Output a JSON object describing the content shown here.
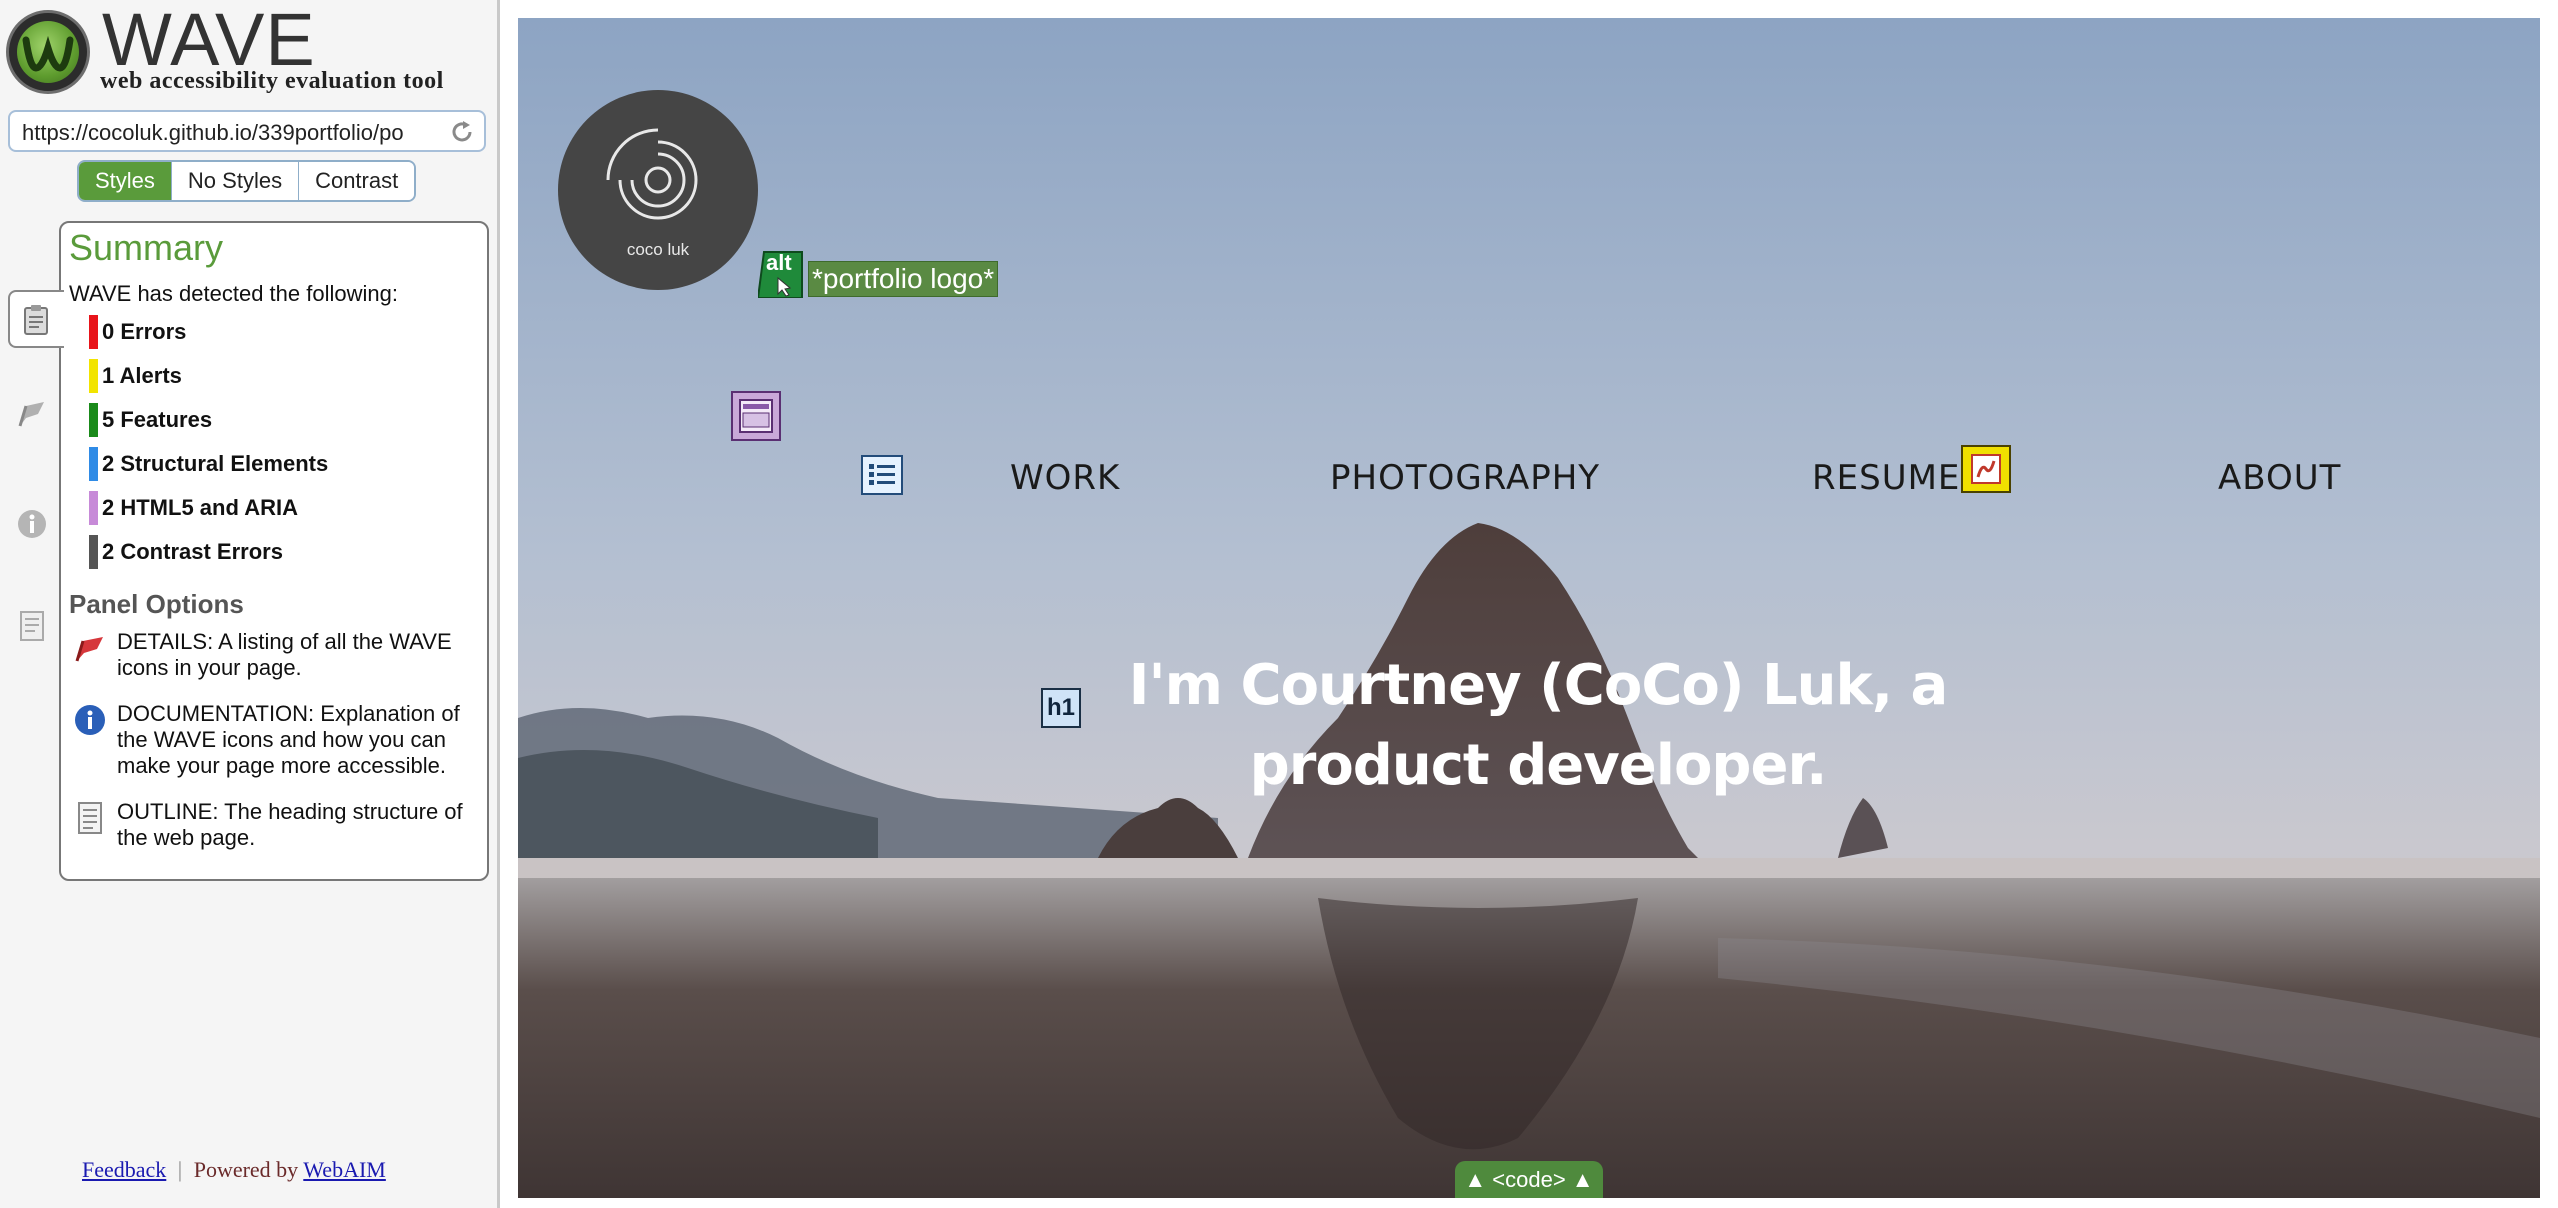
{
  "wave": {
    "title": "WAVE",
    "subtitle": "web accessibility evaluation tool",
    "url": "https://cocoluk.github.io/339portfolio/po",
    "view_tabs": [
      "Styles",
      "No Styles",
      "Contrast"
    ],
    "active_view": "Styles",
    "summary": {
      "title": "Summary",
      "intro": "WAVE has detected the following:",
      "stats": [
        {
          "label": "0 Errors",
          "color": "#e8141a"
        },
        {
          "label": "1 Alerts",
          "color": "#f2e400"
        },
        {
          "label": "5 Features",
          "color": "#1a8a1a"
        },
        {
          "label": "2 Structural Elements",
          "color": "#2f8be6"
        },
        {
          "label": "2 HTML5 and ARIA",
          "color": "#c78ad8"
        },
        {
          "label": "2 Contrast Errors",
          "color": "#555555"
        }
      ],
      "panel_options_title": "Panel Options",
      "options": [
        {
          "icon": "flag-icon",
          "text": "DETAILS: A listing of all the WAVE icons in your page."
        },
        {
          "icon": "info-icon",
          "text": "DOCUMENTATION: Explanation of the WAVE icons and how you can make your page more accessible."
        },
        {
          "icon": "outline-icon",
          "text": "OUTLINE: The heading structure of the web page."
        }
      ]
    },
    "footer": {
      "feedback": "Feedback",
      "separator": "|",
      "powered_by": "Powered by",
      "webaim": "WebAIM"
    }
  },
  "site": {
    "logo_text": "coco luk",
    "alt_badge": "alt",
    "alt_text": "*portfolio logo*",
    "nav": [
      "WORK",
      "PHOTOGRAPHY",
      "RESUME",
      "ABOUT"
    ],
    "h1_badge": "h1",
    "hero_heading": "I'm Courtney (CoCo) Luk, a product developer.",
    "code_toggle": "▲ <code> ▲"
  }
}
